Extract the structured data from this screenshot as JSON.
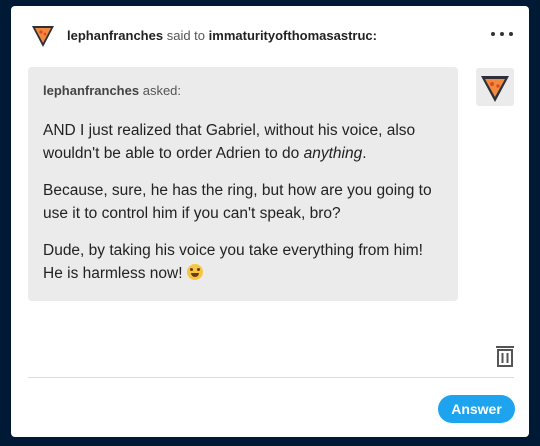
{
  "post": {
    "author": "lephanfranches",
    "said_to_text": "said to",
    "recipient": "immaturityofthomasastruc:",
    "more_icon": "ellipsis-icon"
  },
  "ask": {
    "asker": "lephanfranches",
    "asked_text": "asked:",
    "para1_start": "AND I just realized that Gabriel, without his voice, also wouldn't be able to order Adrien to do ",
    "para1_em": "anything",
    "para1_end": ".",
    "para2": "Because, sure, he has the ring, but how are you going to use it to control him if you can't speak, bro?",
    "para3_start": "Dude, by taking his voice you take everything from him! He is harmless now! ",
    "emoji": "rolling-on-floor-laughing-emoji"
  },
  "actions": {
    "delete_icon": "trash-icon",
    "answer_label": "Answer"
  },
  "colors": {
    "background": "#001935",
    "accent": "#1ea4ee",
    "bubble": "#ebebeb"
  }
}
